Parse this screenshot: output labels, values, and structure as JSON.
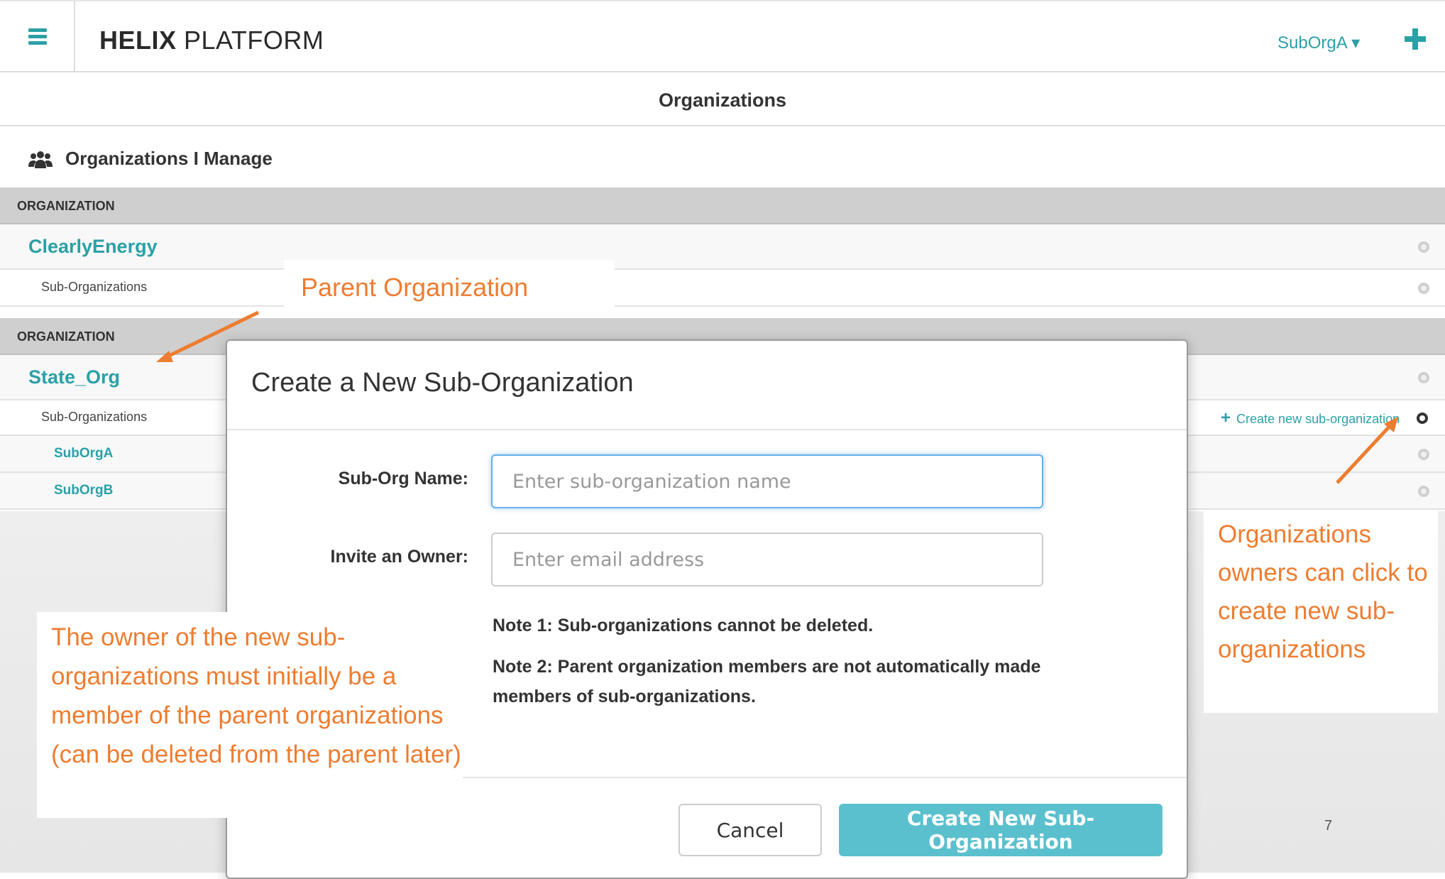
{
  "header": {
    "brand_bold": "HELIX",
    "brand_light": " PLATFORM",
    "user_dropdown": "SubOrgA ▾",
    "menu_icon": "hamburger-icon",
    "add_icon": "plus-icon"
  },
  "page": {
    "title": "Organizations"
  },
  "manage": {
    "heading": "Organizations I Manage",
    "icon": "users-icon"
  },
  "orgs": [
    {
      "header": "ORGANIZATION",
      "name": "ClearlyEnergy",
      "sub_label": "Sub-Organizations",
      "subs": []
    },
    {
      "header": "ORGANIZATION",
      "name": "State_Org",
      "sub_label": "Sub-Organizations",
      "subs": [
        "SubOrgA",
        "SubOrgB"
      ],
      "create_link": "Create new sub-organization"
    }
  ],
  "modal": {
    "title": "Create a New Sub-Organization",
    "name_label": "Sub-Org Name:",
    "name_placeholder": "Enter sub-organization name",
    "owner_label": "Invite an Owner:",
    "owner_placeholder": "Enter email address",
    "note1": "Note 1: Sub-organizations cannot be deleted.",
    "note2": "Note 2: Parent organization members are not automatically made members of sub-organizations.",
    "cancel": "Cancel",
    "create": "Create New Sub-Organization"
  },
  "annotations": {
    "parent": "Parent Organization",
    "owners": "Organizations owners can click to create new sub-organizations",
    "owner_note": "The owner of the new sub-organizations must initially be a member of the parent organizations (can be deleted from the parent later)",
    "color": "#ed7d31"
  },
  "slide_number": "7",
  "colors": {
    "accent": "#2ba0a6",
    "button": "#5bc0ce",
    "header_gray": "#cfcfcf"
  }
}
